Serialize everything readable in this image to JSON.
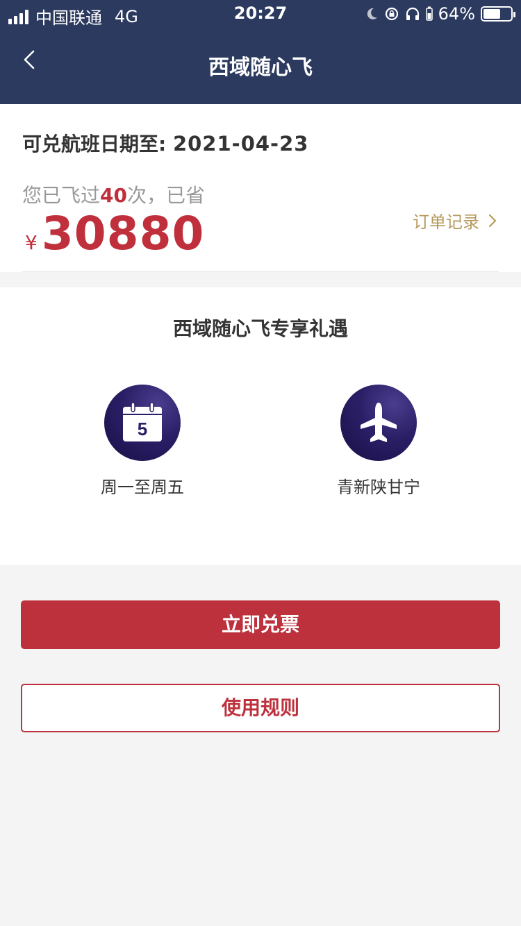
{
  "status_bar": {
    "carrier": "中国联通",
    "network": "4G",
    "time": "20:27",
    "battery_percent_text": "64%",
    "battery_level": 0.64
  },
  "nav": {
    "back_icon": "chevron-left-icon",
    "title": "西域随心飞"
  },
  "summary": {
    "date_label": "可兑航班日期至:",
    "date_value": "2021-04-23",
    "flown_prefix": "您已飞过",
    "flown_count": "40",
    "flown_suffix": "次，已省",
    "currency": "¥",
    "saved_amount": "30880",
    "orders_link": "订单记录"
  },
  "benefits": {
    "heading": "西域随心飞专享礼遇",
    "items": [
      {
        "icon": "calendar-icon",
        "icon_text": "5",
        "label": "周一至周五"
      },
      {
        "icon": "airplane-icon",
        "label": "青新陕甘宁"
      }
    ]
  },
  "actions": {
    "redeem": "立即兑票",
    "rules": "使用规则"
  },
  "colors": {
    "header_bg": "#2b3a5e",
    "accent_red": "#bd313d",
    "gold": "#b69a5c",
    "icon_bg": "#2a1f66"
  }
}
